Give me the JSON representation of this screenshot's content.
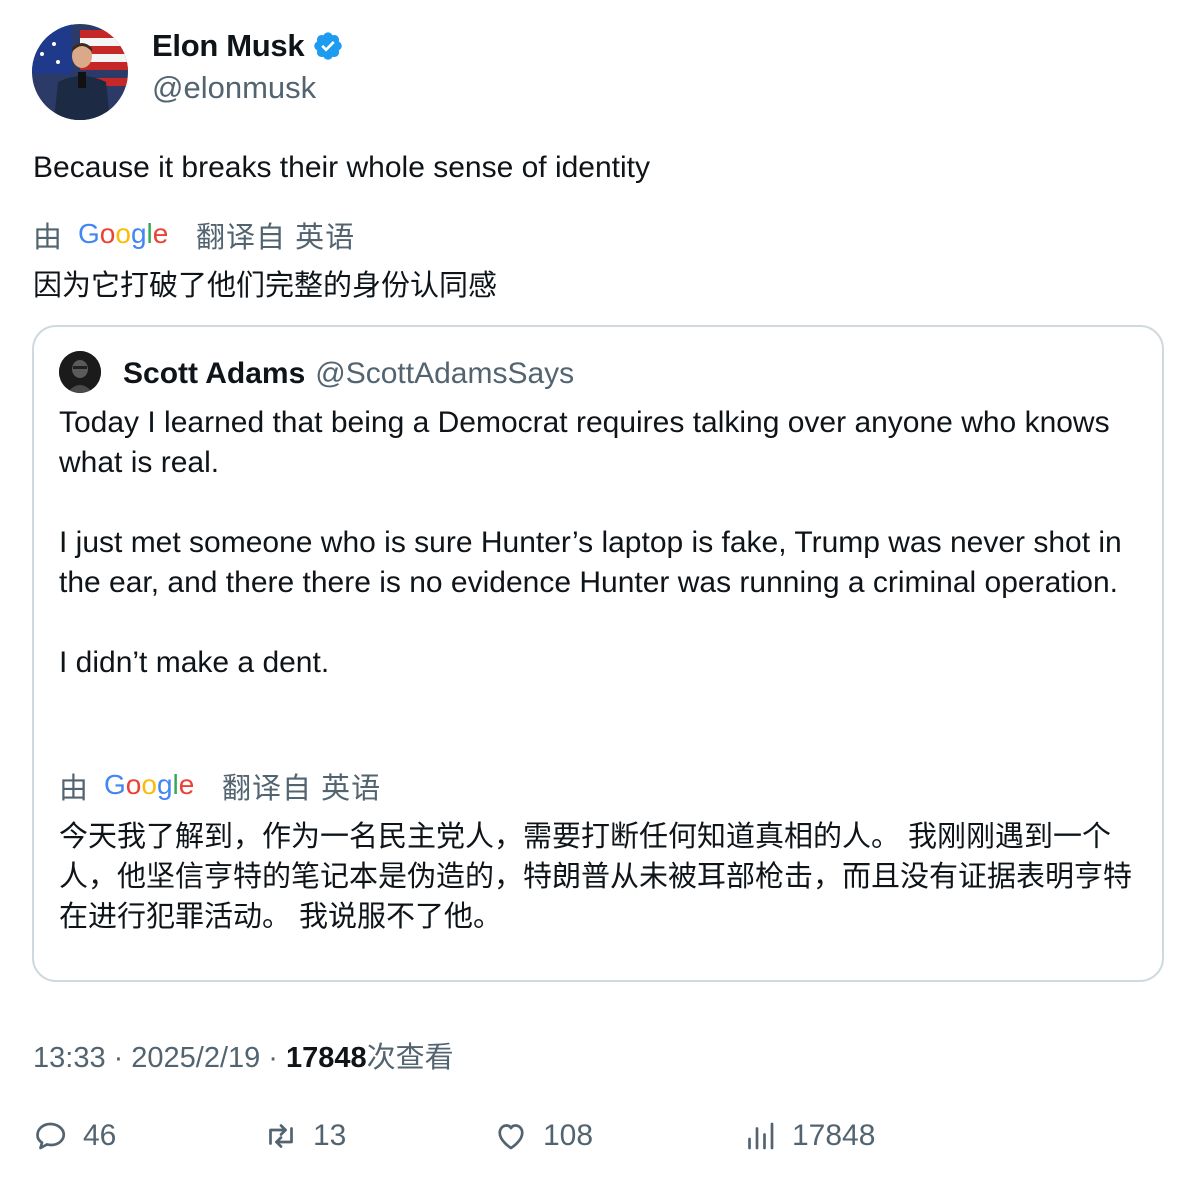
{
  "author": {
    "name": "Elon Musk",
    "handle": "@elonmusk",
    "verified": true
  },
  "tweet": {
    "text": "Because it breaks their whole sense of identity",
    "translation": {
      "by": "由",
      "provider": "Google",
      "from": "翻译自 英语",
      "text": "因为它打破了他们完整的身份认同感"
    }
  },
  "quote": {
    "name": "Scott Adams",
    "handle": "@ScottAdamsSays",
    "text": "Today I learned that being a Democrat requires talking over anyone who knows what is real.\n\nI just met someone who is sure Hunter’s laptop is fake, Trump was never shot in the ear, and there there is no evidence Hunter was running a criminal operation.\n\nI didn’t make a dent.",
    "translation": {
      "by": "由",
      "provider": "Google",
      "from": "翻译自 英语",
      "text": "今天我了解到，作为一名民主党人，需要打断任何知道真相的人。 我刚刚遇到一个人，他坚信亨特的笔记本是伪造的，特朗普从未被耳部枪击，而且没有证据表明亨特在进行犯罪活动。 我说服不了他。"
    }
  },
  "meta": {
    "time": "13:33",
    "date": "2025/2/19",
    "views": "17848",
    "views_label": "次查看",
    "separator": "·"
  },
  "actions": {
    "replies": "46",
    "retweets": "13",
    "likes": "108",
    "views": "17848"
  },
  "colors": {
    "text": "#0f1419",
    "secondary": "#536471",
    "verified": "#1d9bf0",
    "border": "#cfd9de"
  },
  "icons": [
    "verified-badge-icon",
    "google-logo",
    "reply-icon",
    "retweet-icon",
    "like-icon",
    "views-icon"
  ]
}
